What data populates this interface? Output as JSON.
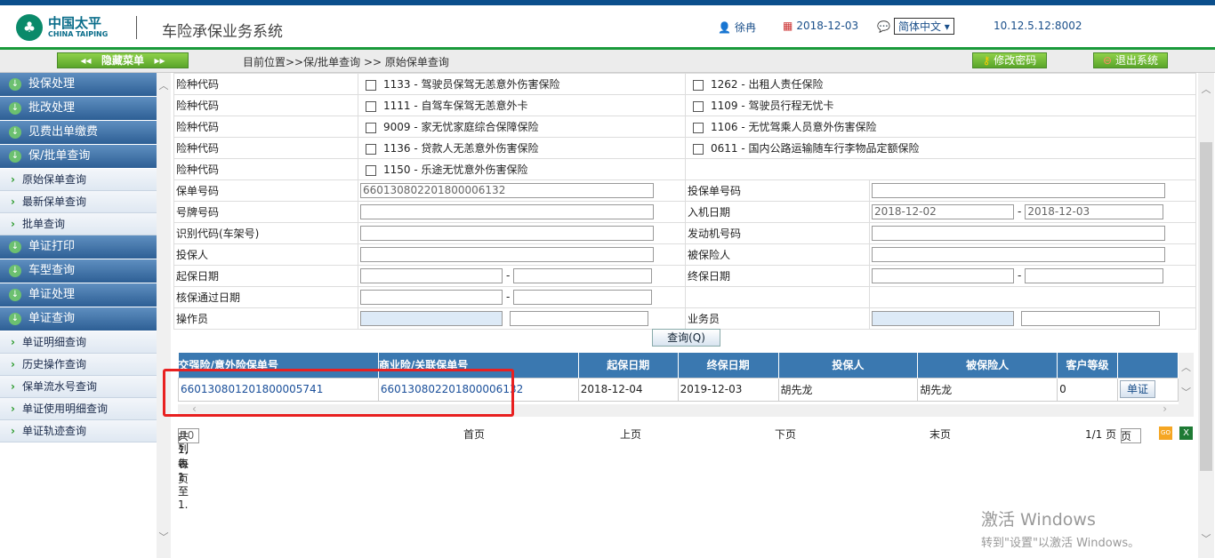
{
  "header": {
    "logo_cn": "中国太平",
    "logo_en": "CHINA TAIPING",
    "title": "车险承保业务系统",
    "user": "徐冉",
    "date": "2018-12-03",
    "language": "简体中文",
    "server": "10.12.5.12:8002"
  },
  "navbar": {
    "hide_menu": "隐藏菜单",
    "breadcrumb": "目前位置>>保/批单查询 >> 原始保单查询",
    "change_password": "修改密码",
    "logout": "退出系统"
  },
  "sidebar": [
    {
      "type": "group",
      "label": "投保处理"
    },
    {
      "type": "group",
      "label": "批改处理"
    },
    {
      "type": "group",
      "label": "见费出单缴费"
    },
    {
      "type": "group",
      "label": "保/批单查询"
    },
    {
      "type": "item",
      "label": "原始保单查询"
    },
    {
      "type": "item",
      "label": "最新保单查询"
    },
    {
      "type": "item",
      "label": "批单查询"
    },
    {
      "type": "group",
      "label": "单证打印"
    },
    {
      "type": "group",
      "label": "车型查询"
    },
    {
      "type": "group",
      "label": "单证处理"
    },
    {
      "type": "group",
      "label": "单证查询"
    },
    {
      "type": "item",
      "label": "单证明细查询"
    },
    {
      "type": "item",
      "label": "历史操作查询"
    },
    {
      "type": "item",
      "label": "保单流水号查询"
    },
    {
      "type": "item",
      "label": "单证使用明细查询"
    },
    {
      "type": "item",
      "label": "单证轨迹查询"
    }
  ],
  "form": {
    "risk_label": "险种代码",
    "risks": [
      [
        "1133 - 驾驶员保驾无恙意外伤害保险",
        "1262 - 出租人责任保险"
      ],
      [
        "1111 - 自驾车保驾无恙意外卡",
        "1109 - 驾驶员行程无忧卡"
      ],
      [
        "9009 - 家无忧家庭综合保障保险",
        "1106 - 无忧驾乘人员意外伤害保险"
      ],
      [
        "1136 - 贷款人无恙意外伤害保险",
        "0611 - 国内公路运输随车行李物品定额保险"
      ],
      [
        "1150 - 乐途无忧意外伤害保险",
        ""
      ]
    ],
    "policy_no_label": "保单号码",
    "policy_no": "660130802201800006132",
    "proposal_no_label": "投保单号码",
    "plate_label": "号牌号码",
    "entry_date_label": "入机日期",
    "entry_date_from": "2018-12-02",
    "entry_date_to": "2018-12-03",
    "vin_label": "识别代码(车架号)",
    "engine_label": "发动机号码",
    "applicant_label": "投保人",
    "insured_label": "被保险人",
    "start_date_label": "起保日期",
    "end_date_label": "终保日期",
    "approve_date_label": "核保通过日期",
    "operator_label": "操作员",
    "salesman_label": "业务员",
    "query_button": "查询(Q)",
    "dash": "-"
  },
  "results": {
    "columns": [
      "交强险/意外险保单号",
      "商业险/关联保单号",
      "起保日期",
      "终保日期",
      "投保人",
      "被保险人",
      "客户等级",
      ""
    ],
    "rows": [
      [
        "660130801201800005741",
        "660130802201800006132",
        "2018-12-04",
        "2019-12-03",
        "胡先龙",
        "胡先龙",
        "0",
        "单证"
      ]
    ]
  },
  "pager": {
    "summary_a": "共 1,每页",
    "page_size": "10",
    "summary_b": ",列表 1 至 1.",
    "first": "首页",
    "prev": "上页",
    "next": "下页",
    "last": "末页",
    "page_info": "1/1 页",
    "page_suffix": "页"
  },
  "watermark": {
    "line1": "激活 Windows",
    "line2": "转到\"设置\"以激活 Windows。"
  }
}
